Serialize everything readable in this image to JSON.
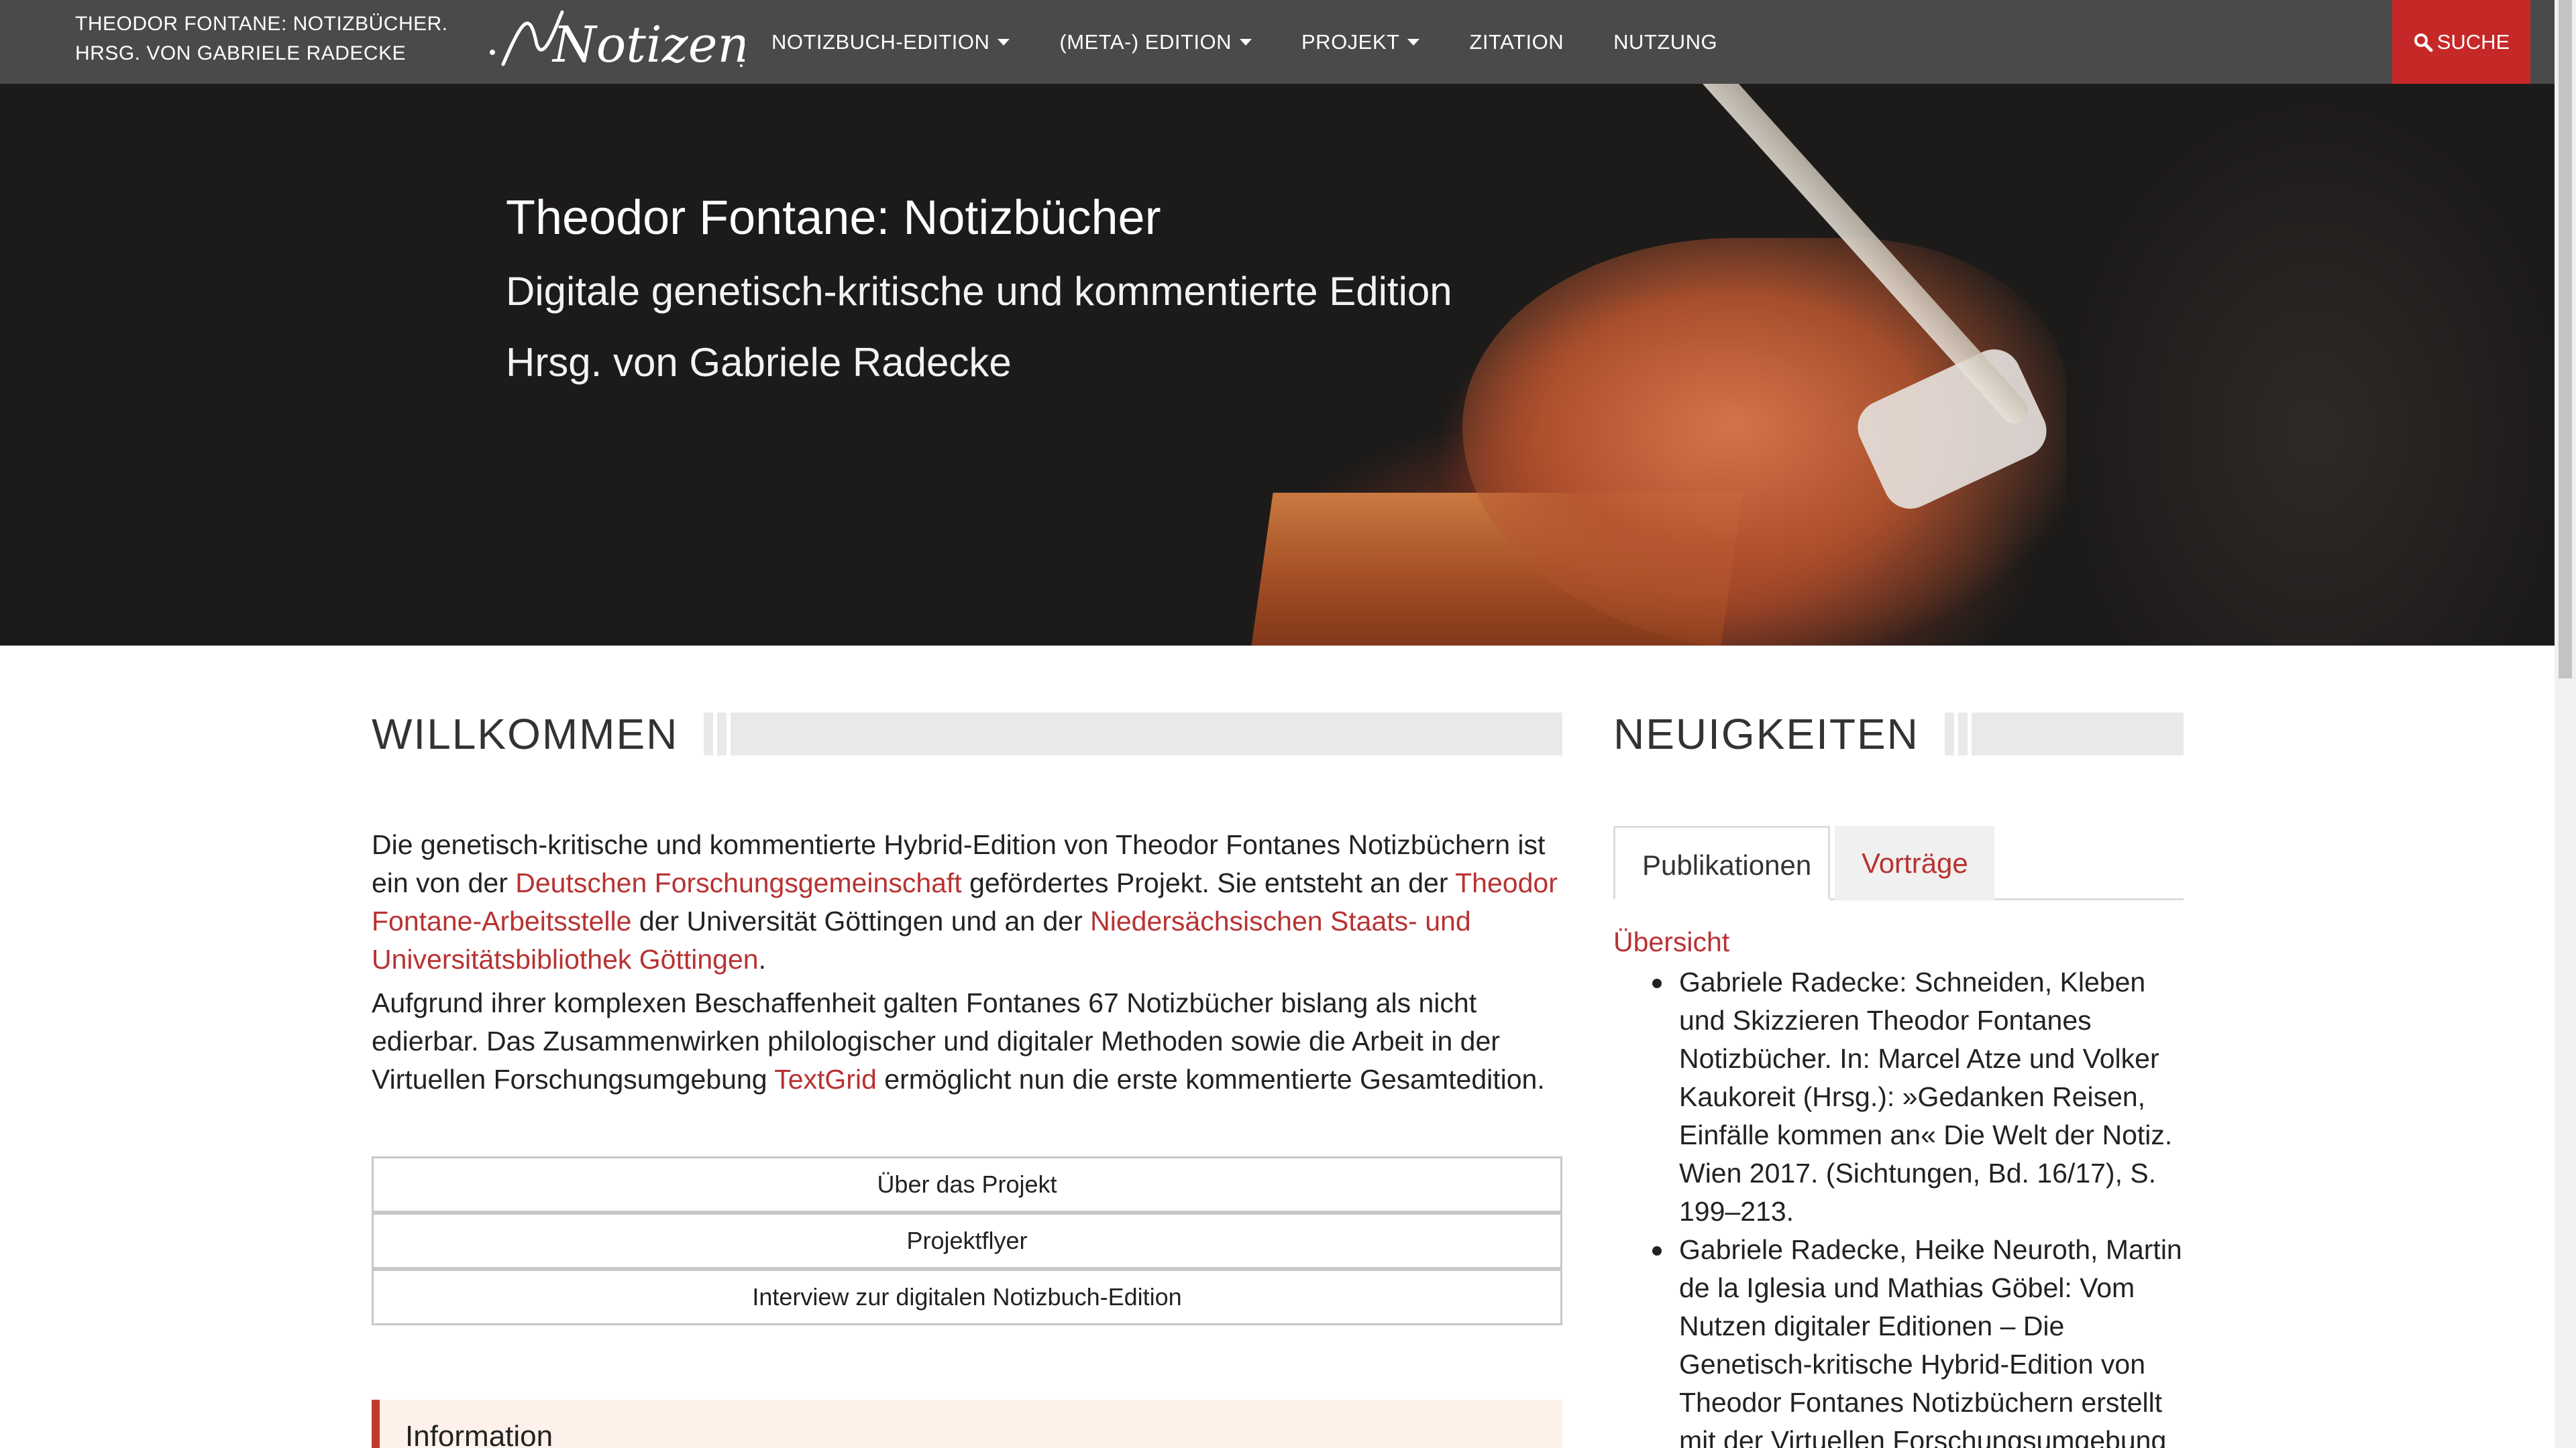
{
  "header": {
    "brand_line1": "THEODOR FONTANE: NOTIZBÜCHER.",
    "brand_line2": "HRSG. VON GABRIELE RADECKE",
    "logo_text": "Notizen",
    "nav": [
      {
        "label": "NOTIZBUCH-EDITION",
        "has_caret": true
      },
      {
        "label": "(META-) EDITION",
        "has_caret": true
      },
      {
        "label": "PROJEKT",
        "has_caret": true
      },
      {
        "label": "ZITATION",
        "has_caret": false
      },
      {
        "label": "NUTZUNG",
        "has_caret": false
      }
    ],
    "search_label": "SUCHE",
    "search_icon": "search-icon"
  },
  "hero": {
    "title": "Theodor Fontane: Notizbücher",
    "subtitle": "Digitale genetisch-kritische und kommentierte Edition",
    "editor": "Hrsg. von Gabriele Radecke"
  },
  "welcome": {
    "heading": "WILLKOMMEN",
    "p1": {
      "t1": "Die genetisch-kritische und kommentierte Hybrid-Edition von Theodor Fontanes Notizbüchern ist ein von der ",
      "link1": "Deutschen Forschungsgemeinschaft",
      "t2": " gefördertes Projekt. Sie entsteht an der ",
      "link2": "Theodor Fontane-Arbeitsstelle",
      "t3": " der Universität Göttingen und an der ",
      "link3": "Niedersächsischen Staats- und Universitätsbibliothek Göttingen",
      "t4": "."
    },
    "p2": {
      "t1": "Aufgrund ihrer komplexen Beschaffenheit galten Fontanes 67 Notizbücher bislang als nicht edierbar. Das Zusammenwirken philologischer und digitaler Methoden sowie die Arbeit in der Virtuellen Forschungsumgebung ",
      "link1": "TextGrid",
      "t2": " ermöglicht nun die erste kommentierte Gesamtedition."
    },
    "buttons": [
      "Über das Projekt",
      "Projektflyer",
      "Interview zur digitalen Notizbuch-Edition"
    ],
    "info_title": "Information"
  },
  "news": {
    "heading": "NEUIGKEITEN",
    "tabs": [
      {
        "label": "Publikationen",
        "active": true
      },
      {
        "label": "Vorträge",
        "active": false
      }
    ],
    "overview_link": "Übersicht",
    "publications": [
      "Gabriele Radecke: Schneiden, Kleben und Skizzieren Theodor Fontanes Notizbücher. In: Marcel Atze und Volker Kaukoreit (Hrsg.): »Gedanken Reisen, Einfälle kommen an« Die Welt der Notiz. Wien 2017. (Sichtungen, Bd. 16/17), S. 199–213.",
      "Gabriele Radecke, Heike Neuroth, Martin de la Iglesia und Mathias Göbel: Vom Nutzen digitaler Editionen – Die Genetisch-kritische Hybrid-Edition von Theodor Fontanes Notizbüchern erstellt mit der Virtuellen Forschungsumgebung TextGrid. In: Vom Nutzen der Editionen."
    ]
  },
  "colors": {
    "nav_bg": "#4a4a4a",
    "accent_red": "#c62828",
    "link_red": "#b83232",
    "info_bg": "#fdf1ea"
  }
}
